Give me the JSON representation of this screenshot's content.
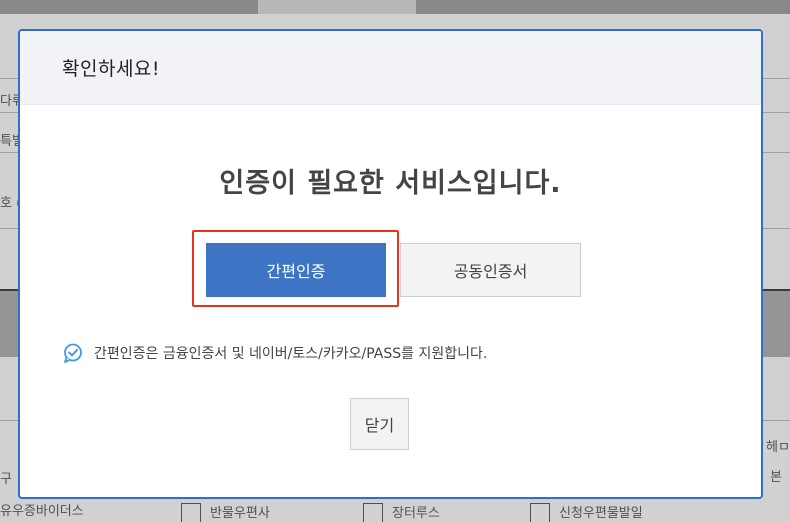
{
  "background": {
    "fragments": [
      "다뤼",
      "특별",
      "호 (",
      "구",
      "유우증바이더스",
      "헤ㅁ",
      "본"
    ],
    "checkbox_labels": [
      "반물우편사",
      "장터루스",
      "신청우편물발일"
    ]
  },
  "modal": {
    "title": "확인하세요!",
    "headline": "인증이 필요한 서비스입니다.",
    "primary_button": "간편인증",
    "secondary_button": "공동인증서",
    "info_text": "간편인증은 금융인증서 및 네이버/토스/카카오/PASS를 지원합니다.",
    "close_button": "닫기",
    "info_icon": "chat-check-icon"
  },
  "colors": {
    "primary": "#3d74c4",
    "highlight": "#e8321e",
    "modal_border": "#2f6fd1",
    "icon": "#3f9be0"
  }
}
